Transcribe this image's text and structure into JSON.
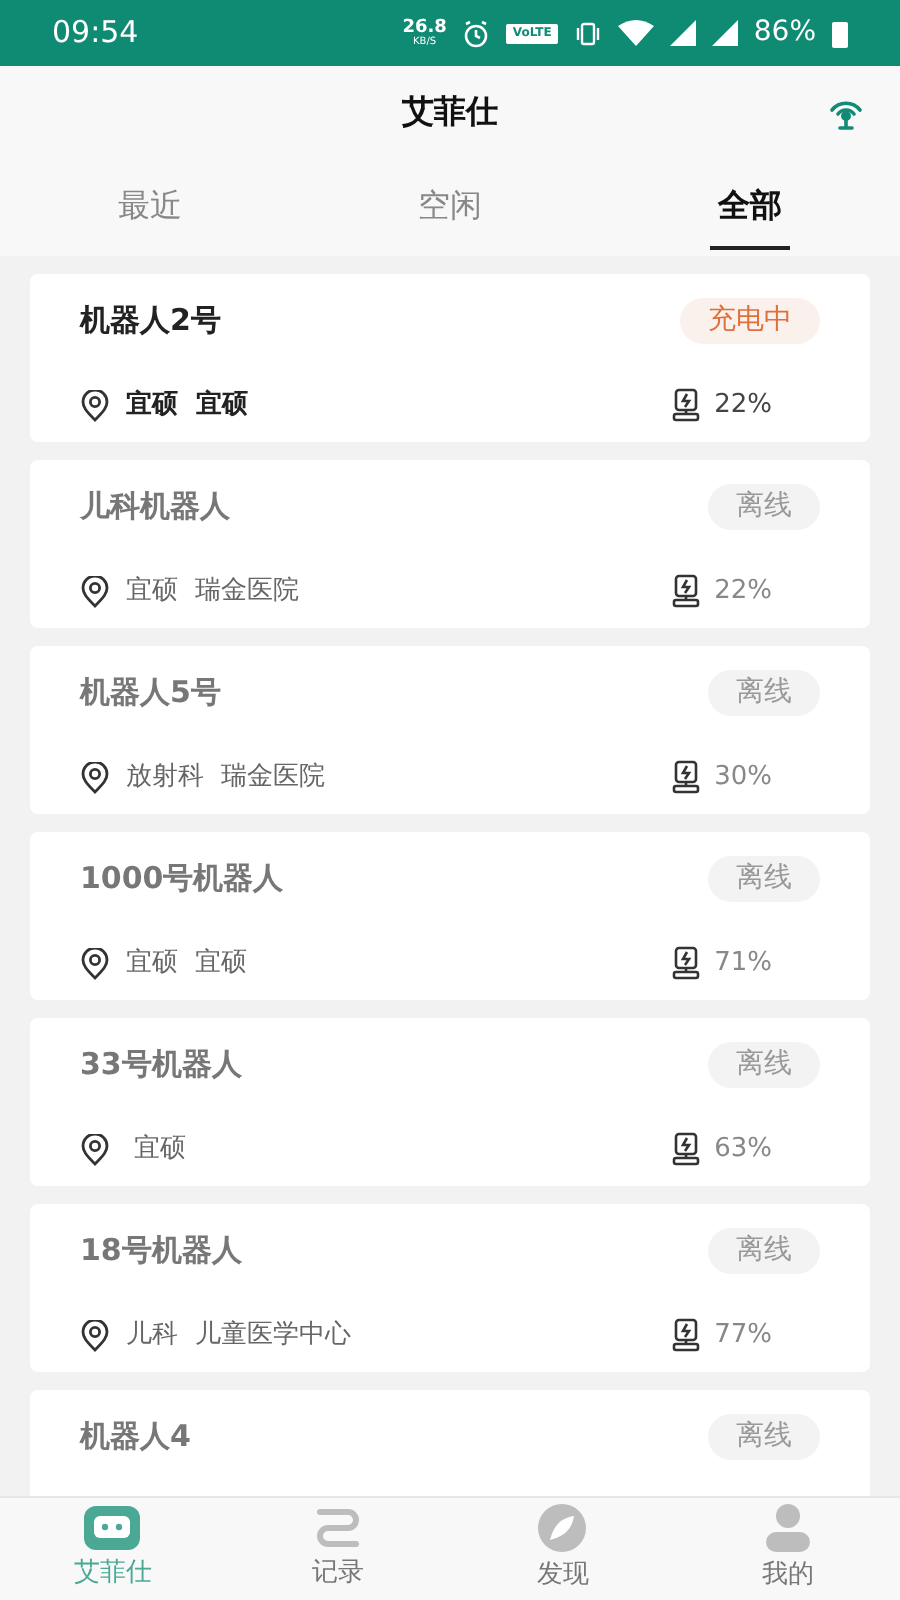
{
  "status_bar": {
    "time": "09:54",
    "speed": "26.8",
    "speed_unit": "KB/S",
    "volte": "VoLTE",
    "battery": "86%"
  },
  "header": {
    "title": "艾菲仕"
  },
  "tabs": [
    {
      "label": "最近",
      "selected": false
    },
    {
      "label": "空闲",
      "selected": false
    },
    {
      "label": "全部",
      "selected": true
    }
  ],
  "robots": [
    {
      "name": "机器人2号",
      "status": "充电中",
      "kind": "charging",
      "location": "宜硕  宜硕",
      "battery": "22%"
    },
    {
      "name": "儿科机器人",
      "status": "离线",
      "kind": "offline",
      "location": "宜硕  瑞金医院",
      "battery": "22%"
    },
    {
      "name": "机器人5号",
      "status": "离线",
      "kind": "offline",
      "location": "放射科  瑞金医院",
      "battery": "30%"
    },
    {
      "name": "1000号机器人",
      "status": "离线",
      "kind": "offline",
      "location": "宜硕  宜硕",
      "battery": "71%"
    },
    {
      "name": "33号机器人",
      "status": "离线",
      "kind": "offline",
      "location": " 宜硕",
      "battery": "63%"
    },
    {
      "name": "18号机器人",
      "status": "离线",
      "kind": "offline",
      "location": "儿科  儿童医学中心",
      "battery": "77%"
    },
    {
      "name": "机器人4",
      "status": "离线",
      "kind": "offline"
    }
  ],
  "bottom_nav": [
    {
      "label": "艾菲仕",
      "kind": "robot",
      "selected": true
    },
    {
      "label": "记录",
      "kind": "route",
      "selected": false
    },
    {
      "label": "发现",
      "kind": "compass",
      "selected": false
    },
    {
      "label": "我的",
      "kind": "person",
      "selected": false
    }
  ]
}
